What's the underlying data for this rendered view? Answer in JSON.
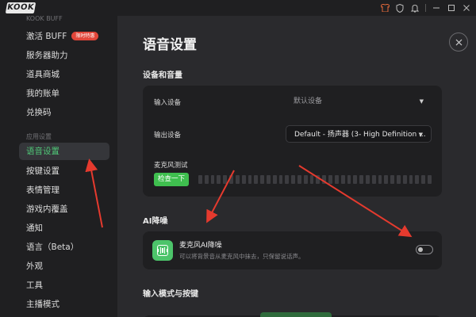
{
  "titlebar": {
    "logo_text": "KOOK",
    "icons": [
      "shirt-icon",
      "shield-icon",
      "bell-icon",
      "minimize-icon",
      "maximize-icon",
      "close-icon"
    ]
  },
  "sidebar": {
    "section_top_label": "KOOK BUFF",
    "items_top": [
      {
        "label": "激活 BUFF",
        "badge": "限时特惠"
      },
      {
        "label": "服务器助力"
      },
      {
        "label": "道具商城"
      },
      {
        "label": "我的账单"
      },
      {
        "label": "兑换码"
      }
    ],
    "section_app_label": "应用设置",
    "items_app": [
      {
        "label": "语音设置",
        "active": true
      },
      {
        "label": "按键设置"
      },
      {
        "label": "表情管理"
      },
      {
        "label": "游戏内覆盖"
      },
      {
        "label": "通知"
      },
      {
        "label": "语言（Beta）"
      },
      {
        "label": "外观"
      },
      {
        "label": "工具"
      },
      {
        "label": "主播模式"
      }
    ]
  },
  "main": {
    "title": "语音设置",
    "device_section": {
      "title": "设备和音量",
      "input_label": "输入设备",
      "input_value": "默认设备",
      "output_label": "输出设备",
      "output_value": "Default - 扬声器 (3- High Definition ...",
      "mic_test_label": "麦克风测试",
      "check_button": "检查一下"
    },
    "ai_section": {
      "title": "AI降噪",
      "item_title": "麦克风AI降噪",
      "item_desc": "可以将背景音从麦克风中抹去，只保留说话声。",
      "toggle_on": false
    },
    "input_mode_section": {
      "title": "输入模式与按键"
    }
  },
  "colors": {
    "accent_green": "#3fbf4f",
    "active_text": "#50c878",
    "badge_red": "#e2463a",
    "annotation_red": "#e53a2e"
  }
}
